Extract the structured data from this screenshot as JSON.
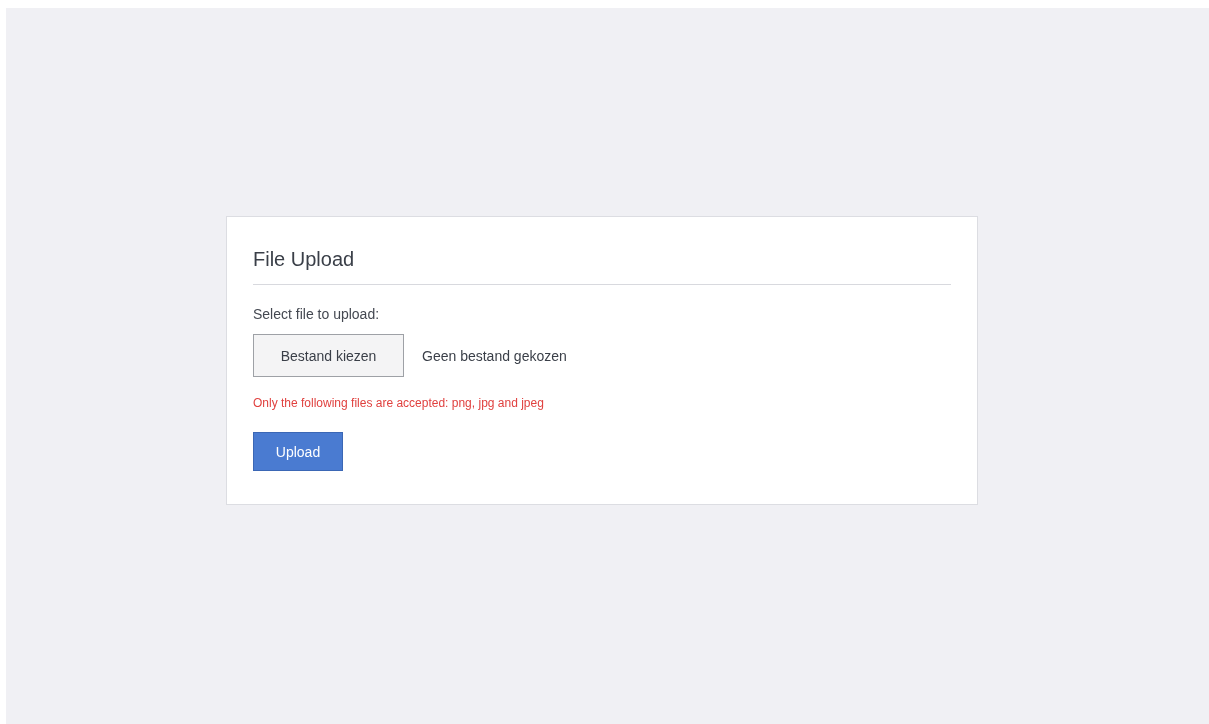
{
  "card": {
    "title": "File Upload",
    "label": "Select file to upload:",
    "file_input": {
      "button": "Bestand kiezen",
      "status": "Geen bestand gekozen"
    },
    "note": "Only the following files are accepted: png, jpg and jpeg",
    "submit": "Upload"
  }
}
